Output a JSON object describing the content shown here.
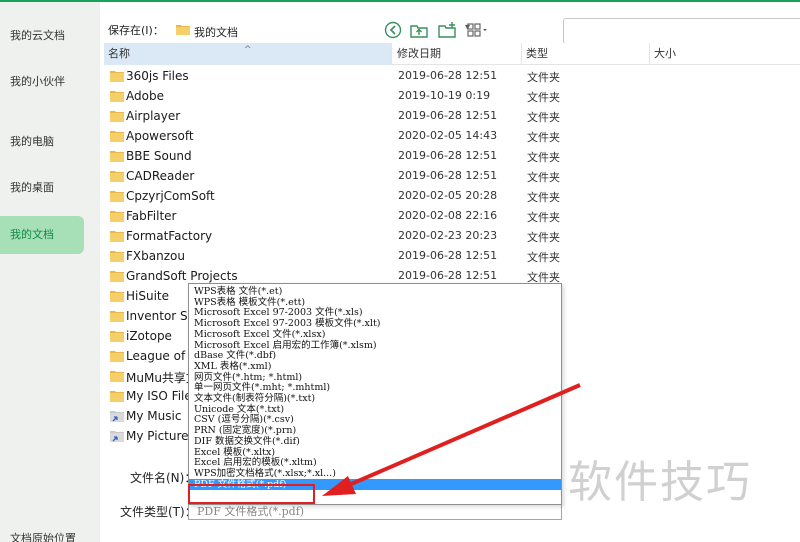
{
  "sidebar": {
    "items": [
      {
        "label": "我的云文档",
        "active": false
      },
      {
        "label": "我的小伙伴",
        "active": false
      },
      {
        "label": "我的电脑",
        "active": false
      },
      {
        "label": "我的桌面",
        "active": false
      },
      {
        "label": "我的文档",
        "active": true
      }
    ],
    "footer": "文档原始位置"
  },
  "toolbar": {
    "save_in_label": "保存在(I)：",
    "path": "我的文档",
    "buttons": [
      "back-icon",
      "up-folder-icon",
      "new-folder-icon",
      "view-menu-icon"
    ],
    "search_placeholder": ""
  },
  "columns": {
    "name": "名称",
    "date": "修改日期",
    "type": "类型",
    "size": "大小"
  },
  "files": [
    {
      "name": "360js Files",
      "date": "2019-06-28 12:51",
      "type": "文件夹",
      "icon": "folder-icon"
    },
    {
      "name": "Adobe",
      "date": "2019-10-19 0:19",
      "type": "文件夹",
      "icon": "folder-icon"
    },
    {
      "name": "Airplayer",
      "date": "2019-06-28 12:51",
      "type": "文件夹",
      "icon": "folder-icon"
    },
    {
      "name": "Apowersoft",
      "date": "2020-02-05 14:43",
      "type": "文件夹",
      "icon": "folder-icon"
    },
    {
      "name": "BBE Sound",
      "date": "2019-06-28 12:51",
      "type": "文件夹",
      "icon": "folder-icon"
    },
    {
      "name": "CADReader",
      "date": "2019-06-28 12:51",
      "type": "文件夹",
      "icon": "folder-icon"
    },
    {
      "name": "CpzyrjComSoft",
      "date": "2020-02-05 20:28",
      "type": "文件夹",
      "icon": "folder-icon"
    },
    {
      "name": "FabFilter",
      "date": "2020-02-08 22:16",
      "type": "文件夹",
      "icon": "folder-icon"
    },
    {
      "name": "FormatFactory",
      "date": "2020-02-23 20:23",
      "type": "文件夹",
      "icon": "folder-icon"
    },
    {
      "name": "FXbanzou",
      "date": "2019-06-28 12:51",
      "type": "文件夹",
      "icon": "folder-icon"
    },
    {
      "name": "GrandSoft Projects",
      "date": "2019-06-28 12:51",
      "type": "文件夹",
      "icon": "folder-icon"
    },
    {
      "name": "HiSuite",
      "date": "",
      "type": "",
      "icon": "folder-icon"
    },
    {
      "name": "Inventor Se",
      "date": "",
      "type": "",
      "icon": "folder-icon"
    },
    {
      "name": "iZotope",
      "date": "",
      "type": "",
      "icon": "folder-icon"
    },
    {
      "name": "League of L",
      "date": "",
      "type": "",
      "icon": "folder-icon"
    },
    {
      "name": "MuMu共享文",
      "date": "",
      "type": "",
      "icon": "folder-icon"
    },
    {
      "name": "My ISO Files",
      "date": "",
      "type": "",
      "icon": "folder-icon"
    },
    {
      "name": "My Music",
      "date": "",
      "type": "",
      "icon": "shortcut-folder-icon"
    },
    {
      "name": "My Pictures",
      "date": "",
      "type": "",
      "icon": "shortcut-folder-icon"
    }
  ],
  "file_type_options": [
    "WPS表格 文件(*.et)",
    "WPS表格 模板文件(*.ett)",
    "Microsoft Excel 97-2003 文件(*.xls)",
    "Microsoft Excel 97-2003 模板文件(*.xlt)",
    "Microsoft Excel 文件(*.xlsx)",
    "Microsoft Excel 启用宏的工作簿(*.xlsm)",
    "dBase 文件(*.dbf)",
    "XML 表格(*.xml)",
    "网页文件(*.htm; *.html)",
    "单一网页文件(*.mht; *.mhtml)",
    "文本文件(制表符分隔)(*.txt)",
    "Unicode 文本(*.txt)",
    "CSV (逗号分隔)(*.csv)",
    "PRN (固定宽度)(*.prn)",
    "DIF 数据交换文件(*.dif)",
    "Excel 模板(*.xltx)",
    "Excel 启用宏的模板(*.xltm)",
    "WPS加密文档格式(*.xlsx;*.xl...)",
    "PDF 文件格式(*.pdf)"
  ],
  "selected_option_index": 18,
  "filename_label": "文件名(N)：",
  "filetype_label": "文件类型(T)：",
  "filetype_value": "PDF 文件格式(*.pdf)",
  "watermark": "软件技巧",
  "colors": {
    "accent_green": "#19a25a",
    "selection_blue": "#3399ff",
    "annotation_red": "#e02020"
  }
}
